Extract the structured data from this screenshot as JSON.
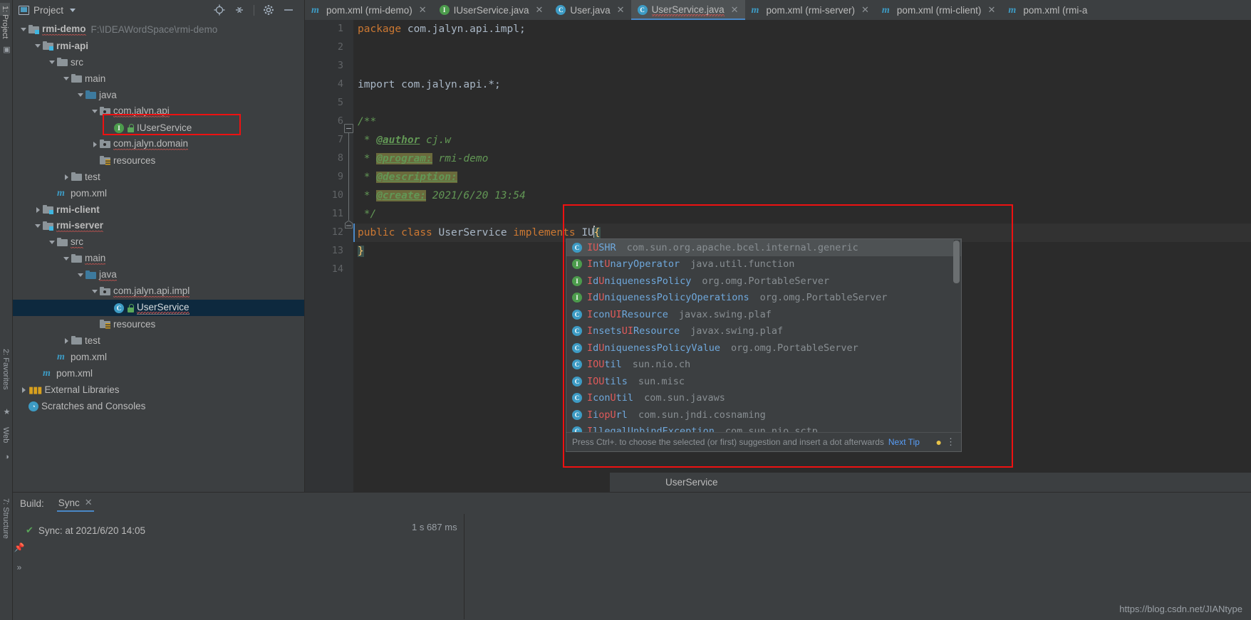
{
  "left_strip": {
    "project_tab": "1: Project",
    "favorites_tab": "2: Favorites",
    "web_tab": "Web",
    "structure_tab": "7: Structure"
  },
  "project_panel": {
    "title": "Project",
    "icons": [
      "locate-icon",
      "collapse-all-icon",
      "gear-icon",
      "minimize-icon"
    ],
    "tree": [
      {
        "indent": 0,
        "arrow": "down",
        "icon": "module-icon",
        "label": "rmi-demo",
        "path": "F:\\IDEAWordSpace\\rmi-demo",
        "bold": true,
        "squiggle": true
      },
      {
        "indent": 1,
        "arrow": "down",
        "icon": "module-icon",
        "label": "rmi-api",
        "path": "",
        "bold": true,
        "squiggle": false
      },
      {
        "indent": 2,
        "arrow": "down",
        "icon": "folder-icon",
        "label": "src",
        "path": "",
        "bold": false,
        "squiggle": false
      },
      {
        "indent": 3,
        "arrow": "down",
        "icon": "folder-icon",
        "label": "main",
        "path": "",
        "bold": false,
        "squiggle": false
      },
      {
        "indent": 4,
        "arrow": "down",
        "icon": "folder-blue-icon",
        "label": "java",
        "path": "",
        "bold": false,
        "squiggle": false
      },
      {
        "indent": 5,
        "arrow": "down",
        "icon": "package-icon",
        "label": "com.jalyn.api",
        "path": "",
        "bold": false,
        "squiggle": true
      },
      {
        "indent": 6,
        "arrow": "none",
        "icon": "interface-icon",
        "label": "IUserService",
        "path": "",
        "bold": false,
        "squiggle": false,
        "lock": true
      },
      {
        "indent": 5,
        "arrow": "right",
        "icon": "package-icon",
        "label": "com.jalyn.domain",
        "path": "",
        "bold": false,
        "squiggle": true
      },
      {
        "indent": 5,
        "arrow": "none",
        "icon": "resources-icon",
        "label": "resources",
        "path": "",
        "bold": false,
        "squiggle": false
      },
      {
        "indent": 3,
        "arrow": "right",
        "icon": "folder-icon",
        "label": "test",
        "path": "",
        "bold": false,
        "squiggle": false
      },
      {
        "indent": 2,
        "arrow": "none",
        "icon": "maven-icon",
        "label": "pom.xml",
        "path": "",
        "bold": false,
        "squiggle": false
      },
      {
        "indent": 1,
        "arrow": "right",
        "icon": "module-icon",
        "label": "rmi-client",
        "path": "",
        "bold": true,
        "squiggle": false
      },
      {
        "indent": 1,
        "arrow": "down",
        "icon": "module-icon",
        "label": "rmi-server",
        "path": "",
        "bold": true,
        "squiggle": true
      },
      {
        "indent": 2,
        "arrow": "down",
        "icon": "folder-icon",
        "label": "src",
        "path": "",
        "bold": false,
        "squiggle": true
      },
      {
        "indent": 3,
        "arrow": "down",
        "icon": "folder-icon",
        "label": "main",
        "path": "",
        "bold": false,
        "squiggle": true
      },
      {
        "indent": 4,
        "arrow": "down",
        "icon": "folder-blue-icon",
        "label": "java",
        "path": "",
        "bold": false,
        "squiggle": true
      },
      {
        "indent": 5,
        "arrow": "down",
        "icon": "package-icon",
        "label": "com.jalyn.api.impl",
        "path": "",
        "bold": false,
        "squiggle": true
      },
      {
        "indent": 6,
        "arrow": "none",
        "icon": "class-icon",
        "label": "UserService",
        "path": "",
        "bold": false,
        "squiggle": true,
        "lock": true,
        "selected": true
      },
      {
        "indent": 5,
        "arrow": "none",
        "icon": "resources-icon",
        "label": "resources",
        "path": "",
        "bold": false,
        "squiggle": false
      },
      {
        "indent": 3,
        "arrow": "right",
        "icon": "folder-icon",
        "label": "test",
        "path": "",
        "bold": false,
        "squiggle": false
      },
      {
        "indent": 2,
        "arrow": "none",
        "icon": "maven-icon",
        "label": "pom.xml",
        "path": "",
        "bold": false,
        "squiggle": false
      },
      {
        "indent": 1,
        "arrow": "none",
        "icon": "maven-icon",
        "label": "pom.xml",
        "path": "",
        "bold": false,
        "squiggle": false
      },
      {
        "indent": 0,
        "arrow": "right",
        "icon": "libraries-icon",
        "label": "External Libraries",
        "path": "",
        "bold": false,
        "squiggle": false
      },
      {
        "indent": 0,
        "arrow": "none",
        "icon": "scratches-icon",
        "label": "Scratches and Consoles",
        "path": "",
        "bold": false,
        "squiggle": false
      }
    ]
  },
  "editor": {
    "tabs": [
      {
        "label": "pom.xml (rmi-demo)",
        "icon": "maven-icon",
        "active": false
      },
      {
        "label": "IUserService.java",
        "icon": "interface-icon",
        "active": false
      },
      {
        "label": "User.java",
        "icon": "class-icon",
        "active": false
      },
      {
        "label": "UserService.java",
        "icon": "class-icon",
        "active": true
      },
      {
        "label": "pom.xml (rmi-server)",
        "icon": "maven-icon",
        "active": false
      },
      {
        "label": "pom.xml (rmi-client)",
        "icon": "maven-icon",
        "active": false
      },
      {
        "label": "pom.xml (rmi-a",
        "icon": "maven-icon",
        "active": false
      }
    ],
    "line_numbers": [
      "1",
      "2",
      "3",
      "4",
      "5",
      "6",
      "7",
      "8",
      "9",
      "10",
      "11",
      "12",
      "13",
      "14"
    ],
    "lines": {
      "l1_keyword": "package",
      "l1_rest": " com.jalyn.api.impl;",
      "l4_text": "import com.jalyn.api.*;",
      "l6_text": "/**",
      "l7_star": " * ",
      "l7_tag": "@author",
      "l7_value": " cj.w",
      "l8_star": " * ",
      "l8_tag": "@program:",
      "l8_value": " rmi-demo",
      "l9_star": " * ",
      "l9_tag": "@description:",
      "l9_value": "",
      "l10_star": " * ",
      "l10_tag": "@create:",
      "l10_value": " 2021/6/20 13:54",
      "l11_text": " */",
      "l12_k1": "public",
      "l12_k2": "class",
      "l12_name": "UserService",
      "l12_k3": "implements",
      "l12_typed": "IU",
      "l12_brace": "{",
      "l13_text": "}"
    },
    "breadcrumb": "UserService"
  },
  "completion_popup": {
    "items": [
      {
        "icon": "class-icon",
        "match": "IU",
        "rest": "SHR",
        "pkg": "com.sun.org.apache.bcel.internal.generic",
        "selected": true
      },
      {
        "icon": "interface-icon",
        "match": "I",
        "rest": "nt",
        "match2": "U",
        "rest2": "naryOperator",
        "pkg": "java.util.function",
        "selected": false
      },
      {
        "icon": "interface-icon",
        "match": "I",
        "rest": "d",
        "match2": "U",
        "rest2": "niquenessPolicy",
        "pkg": "org.omg.PortableServer",
        "selected": false
      },
      {
        "icon": "interface-icon",
        "match": "I",
        "rest": "d",
        "match2": "U",
        "rest2": "niquenessPolicyOperations",
        "pkg": "org.omg.PortableServer",
        "selected": false
      },
      {
        "icon": "class-icon",
        "match": "I",
        "rest": "con",
        "match2": "UI",
        "rest2": "Resource",
        "pkg": "javax.swing.plaf",
        "selected": false
      },
      {
        "icon": "class-icon",
        "match": "I",
        "rest": "nsets",
        "match2": "UI",
        "rest2": "Resource",
        "pkg": "javax.swing.plaf",
        "selected": false
      },
      {
        "icon": "class-icon",
        "match": "I",
        "rest": "d",
        "match2": "U",
        "rest2": "niquenessPolicyValue",
        "pkg": "org.omg.PortableServer",
        "selected": false
      },
      {
        "icon": "class-icon",
        "match": "IO",
        "rest": "",
        "match2": "U",
        "rest2": "til",
        "pkg": "sun.nio.ch",
        "selected": false
      },
      {
        "icon": "class-icon",
        "match": "IO",
        "rest": "",
        "match2": "U",
        "rest2": "tils",
        "pkg": "sun.misc",
        "selected": false
      },
      {
        "icon": "class-icon",
        "match": "I",
        "rest": "con",
        "match2": "U",
        "rest2": "til",
        "pkg": "com.sun.javaws",
        "selected": false
      },
      {
        "icon": "class-icon",
        "match": "I",
        "rest": "i",
        "match2": "opU",
        "rest2": "rl",
        "pkg": "com.sun.jndi.cosnaming",
        "selected": false
      },
      {
        "icon": "class-icon",
        "match": "I",
        "rest": "llegalUnbindException",
        "match2": "",
        "rest2": "",
        "pkg": "com.sun.nio.sctp",
        "selected": false
      }
    ],
    "footer_hint": "Press Ctrl+. to choose the selected (or first) suggestion and insert a dot afterwards",
    "next_tip": "Next Tip"
  },
  "build_panel": {
    "label": "Build:",
    "tab": "Sync",
    "status_text": "Sync: at 2021/6/20 14:05",
    "duration": "1 s 687 ms"
  },
  "watermark": "https://blog.csdn.net/JIANtype",
  "colors": {
    "accent": "#4a88c7",
    "selection": "#0d293e",
    "highlight_box": "#ee1111",
    "keyword": "#cc7832",
    "comment": "#629755",
    "match": "#e05a5a"
  }
}
